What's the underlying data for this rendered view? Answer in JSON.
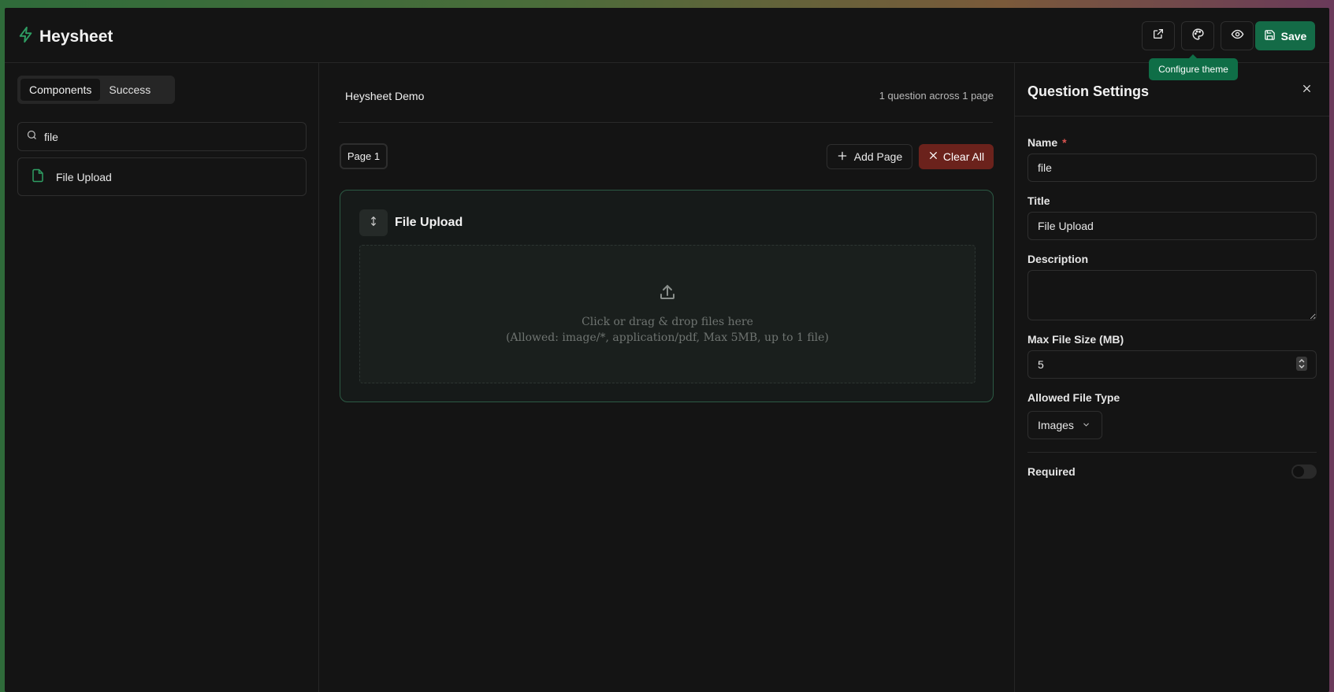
{
  "app": {
    "name": "Heysheet"
  },
  "header": {
    "tooltip": "Configure theme",
    "save_label": "Save"
  },
  "left": {
    "tabs": [
      {
        "label": "Components"
      },
      {
        "label": "Success"
      }
    ],
    "search": {
      "value": "file"
    },
    "results": [
      {
        "label": "File Upload"
      }
    ]
  },
  "center": {
    "form_title": "Heysheet Demo",
    "form_meta": "1 question across 1 page",
    "page_tab": "Page 1",
    "add_page_label": "Add Page",
    "clear_all_label": "Clear All",
    "question": {
      "title": "File Upload",
      "dropzone_line1": "Click or drag & drop files here",
      "dropzone_line2": "(Allowed: image/*, application/pdf, Max 5MB, up to 1 file)"
    }
  },
  "settings": {
    "title": "Question Settings",
    "name_label": "Name",
    "required_star": "*",
    "name_value": "file",
    "title_label": "Title",
    "title_value": "File Upload",
    "description_label": "Description",
    "description_value": "",
    "max_size_label": "Max File Size (MB)",
    "max_size_value": "5",
    "file_type_label": "Allowed File Type",
    "file_type_value": "Images",
    "required_label": "Required",
    "required_on": false
  },
  "colors": {
    "accent": "#146b47",
    "danger": "#6b221c",
    "background": "#141414"
  }
}
